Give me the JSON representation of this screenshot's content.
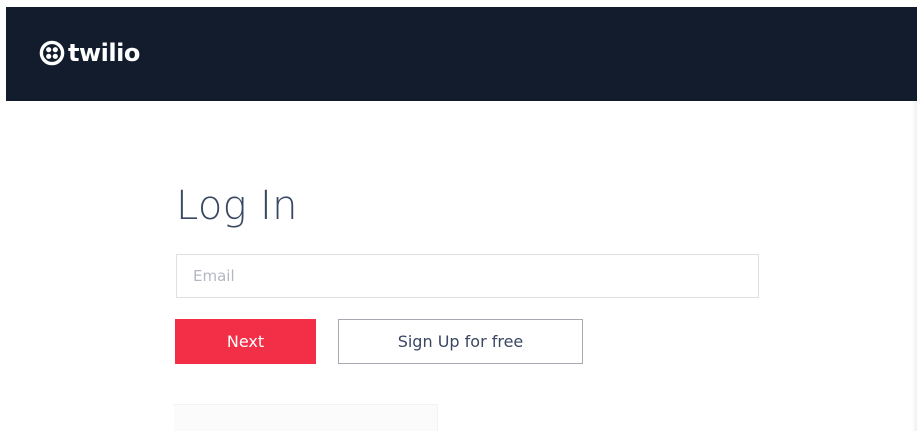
{
  "header": {
    "brand": "twilio",
    "logo_icon": "twilio-logo-icon",
    "background_color": "#121c2d"
  },
  "login": {
    "title": "Log In",
    "email_placeholder": "Email",
    "email_value": "",
    "next_label": "Next",
    "signup_label": "Sign Up for free"
  },
  "colors": {
    "accent": "#f22f46",
    "text": "#394762"
  }
}
